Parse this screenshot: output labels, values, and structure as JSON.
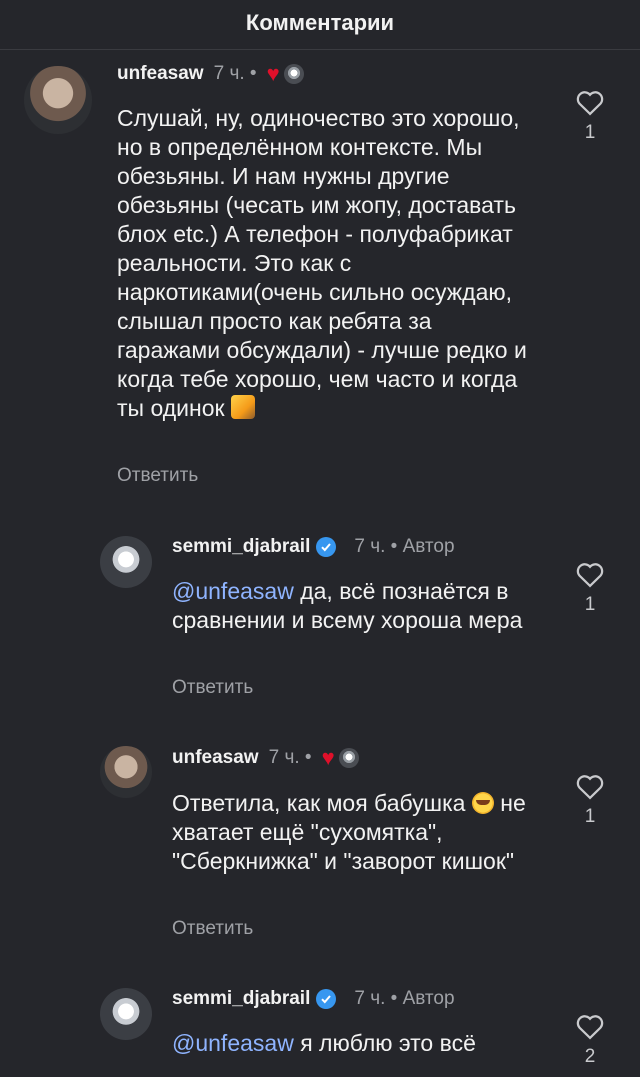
{
  "header": {
    "title": "Комментарии"
  },
  "comments": [
    {
      "username": "unfeasaw",
      "time": "7 ч. •",
      "author_label": "",
      "text": "Слушай, ну, одиночество это хорошо, но в определённом контексте. Мы обезьяны. И нам нужны другие обезьяны (чесать им жопу, доставать блох etc.) А телефон - полуфабрикат реальности. Это как с наркотиками(очень сильно осуждаю, слышал просто как ребята за гаражами обсуждали) - лучше редко и когда тебе хорошо, чем часто и когда ты одинок",
      "mention": "",
      "reply_label": "Ответить",
      "likes": "1"
    },
    {
      "username": "semmi_djabrail",
      "time": "7 ч. • Автор",
      "mention": "@unfeasaw",
      "text": " да, всё познаётся в сравнении и всему хороша мера",
      "reply_label": "Ответить",
      "likes": "1"
    },
    {
      "username": "unfeasaw",
      "time": "7 ч. •",
      "text": "Ответила, как моя бабушка",
      "text2": "не хватает ещё \"сухомятка\", \"Сберкнижка\" и \"заворот кишок\"",
      "reply_label": "Ответить",
      "likes": "1"
    },
    {
      "username": "semmi_djabrail",
      "time": "7 ч. • Автор",
      "mention": "@unfeasaw",
      "text": " я люблю это всё",
      "likes": "2"
    }
  ],
  "colors": {
    "background": "#25262b",
    "mention": "#8fb4ff",
    "heart": "#e0102a",
    "verified": "#3797f0"
  }
}
